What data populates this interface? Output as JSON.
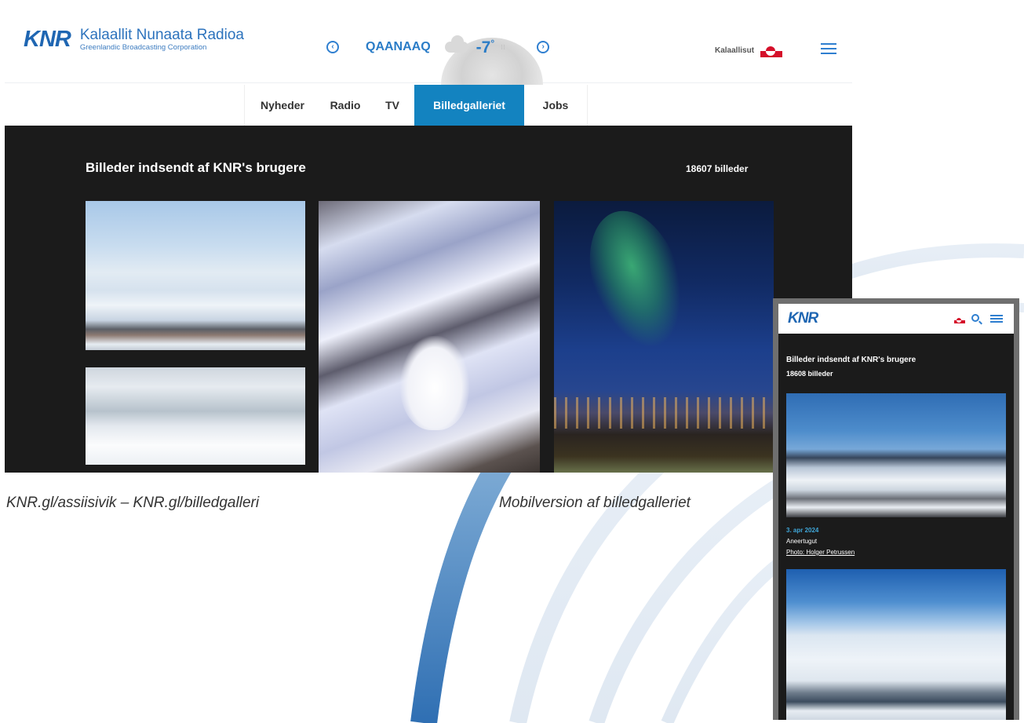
{
  "desktop": {
    "logo": {
      "mark": "KNR",
      "title": "Kalaallit Nunaata Radioa",
      "subtitle": "Greenlandic Broadcasting Corporation"
    },
    "weather": {
      "prev_icon": "chevron-left-circle-icon",
      "city": "QAANAAQ",
      "condition_icon": "cloud-icon",
      "temperature": "-7",
      "temperature_unit": "°",
      "next_icon": "chevron-right-circle-icon"
    },
    "language": {
      "label": "Kalaallisut",
      "flag_icon": "greenland-flag-icon"
    },
    "menu_icon": "hamburger-icon",
    "nav": [
      {
        "label": "Nyheder",
        "active": false
      },
      {
        "label": "Radio",
        "active": false
      },
      {
        "label": "TV",
        "active": false
      },
      {
        "label": "Billedgalleriet",
        "active": true
      },
      {
        "label": "Jobs",
        "active": false
      }
    ],
    "gallery": {
      "heading": "Billeder indsendt af KNR's brugere",
      "count": "18607 billeder"
    }
  },
  "captions": {
    "left": "KNR.gl/assiisivik – KNR.gl/billedgalleri",
    "right": "Mobilversion af billedgalleriet"
  },
  "mobile": {
    "logo": "KNR",
    "flag_icon": "greenland-flag-icon",
    "search_icon": "search-icon",
    "menu_icon": "hamburger-icon",
    "heading": "Billeder indsendt af KNR's brugere",
    "count": "18608 billeder",
    "items": [
      {
        "date": "3. apr 2024",
        "title": "Aneertugut",
        "credit": "Photo: Holger Petrussen"
      }
    ]
  },
  "colors": {
    "brand_blue": "#1f66b2",
    "active_tab": "#1383c0",
    "gallery_bg": "#1b1b1b",
    "date_accent": "#3fa6d8",
    "flag_red": "#d5102a"
  }
}
